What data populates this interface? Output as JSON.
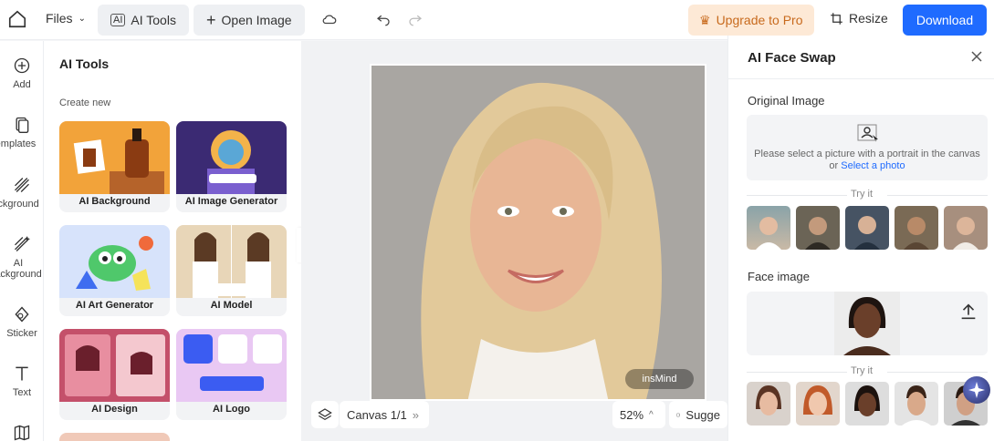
{
  "toolbar": {
    "files_label": "Files",
    "ai_tools_label": "AI Tools",
    "open_image_label": "Open Image",
    "upgrade_label": "Upgrade to Pro",
    "resize_label": "Resize",
    "download_label": "Download"
  },
  "rail": {
    "items": [
      {
        "label": "Add",
        "icon": "plus-circle-icon"
      },
      {
        "label": "emplates",
        "icon": "templates-icon"
      },
      {
        "label": "ackground",
        "icon": "background-icon"
      },
      {
        "label": "AI\nackground",
        "icon": "ai-background-icon"
      },
      {
        "label": "Sticker",
        "icon": "sticker-icon"
      },
      {
        "label": "Text",
        "icon": "text-icon"
      }
    ]
  },
  "ai_panel": {
    "title": "AI Tools",
    "section": "Create new",
    "cards": [
      {
        "label": "AI Background"
      },
      {
        "label": "AI Image Generator"
      },
      {
        "label": "AI Art Generator"
      },
      {
        "label": "AI Model"
      },
      {
        "label": "AI Design"
      },
      {
        "label": "AI Logo"
      }
    ]
  },
  "canvas": {
    "watermark": "insMind",
    "page_label": "Canvas 1/1",
    "zoom": "52%",
    "suggest_label": "Sugge"
  },
  "face_swap": {
    "title": "AI Face Swap",
    "original_label": "Original Image",
    "drop_text": "Please select a picture with a portrait in the canvas",
    "drop_or": "or",
    "drop_link": "Select a photo",
    "try_label": "Try it",
    "face_label": "Face image",
    "try_label_2": "Try it"
  },
  "colors": {
    "accent": "#1f6bff",
    "upgrade_bg": "#fde9d6",
    "upgrade_text": "#c86a1d"
  }
}
